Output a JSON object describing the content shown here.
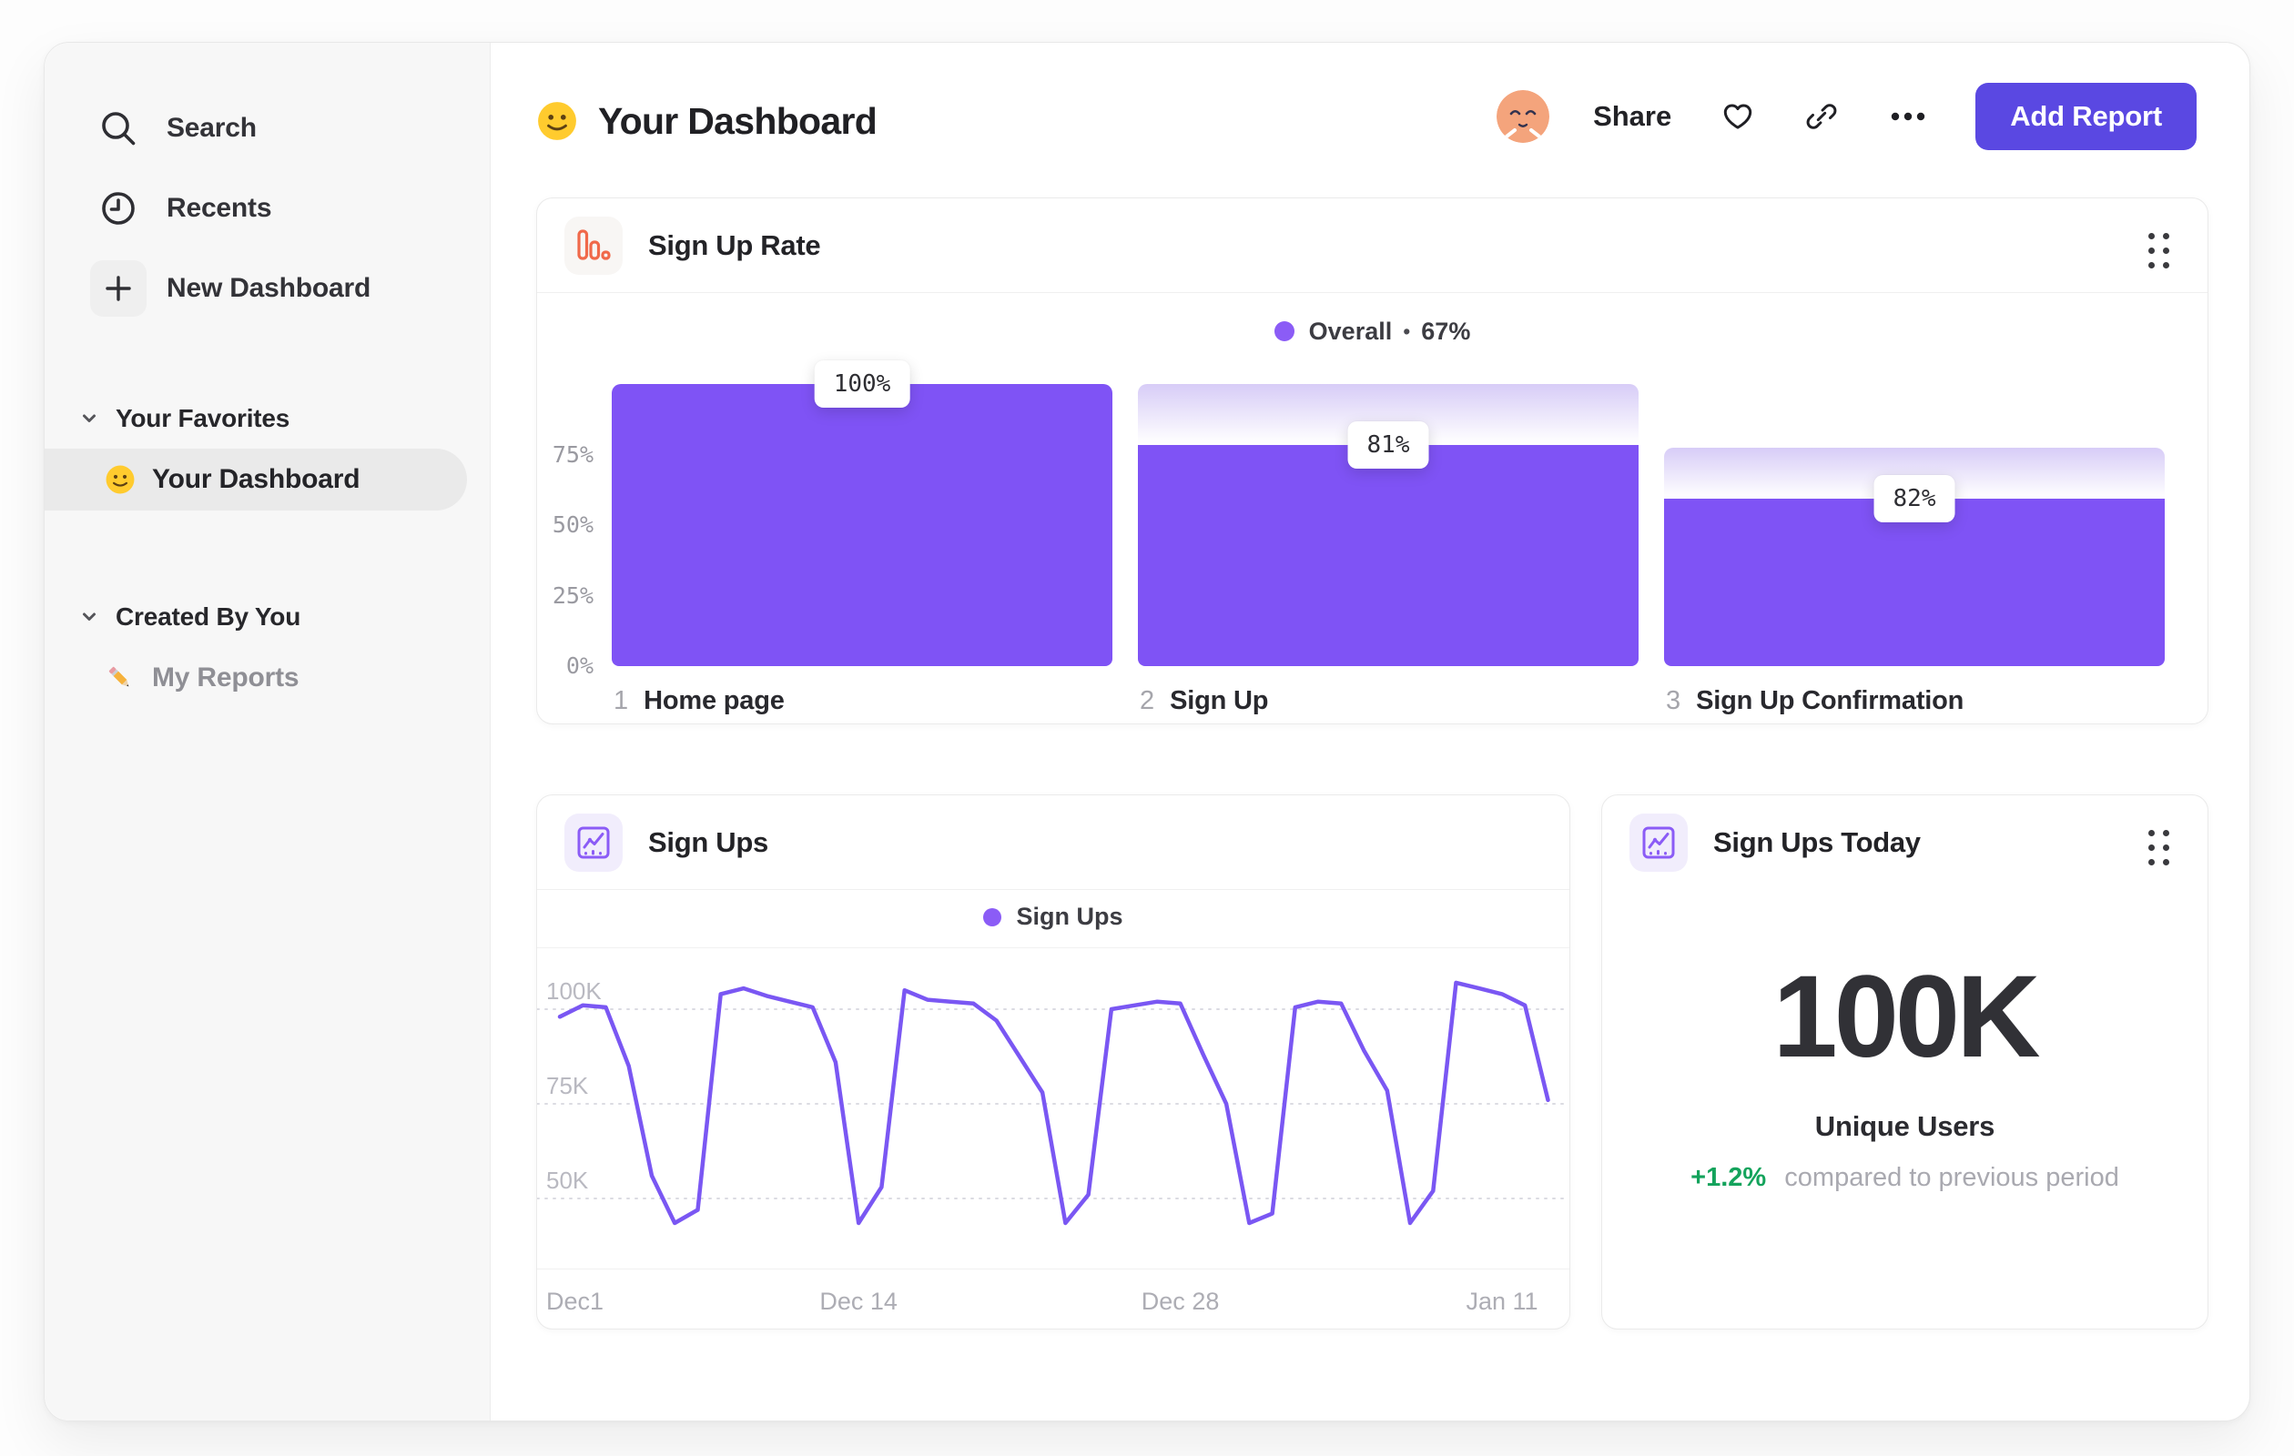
{
  "app": {
    "header": {
      "emoji": "slightly-smiling-face",
      "title": "Your Dashboard",
      "share_label": "Share",
      "add_report_label": "Add Report"
    },
    "sidebar": {
      "nav": [
        {
          "icon": "search-icon",
          "label": "Search"
        },
        {
          "icon": "clock-icon",
          "label": "Recents"
        },
        {
          "icon": "plus-icon",
          "label": "New Dashboard"
        }
      ],
      "sections": [
        {
          "title": "Your Favorites",
          "items": [
            {
              "emoji": "slightly-smiling-face",
              "label": "Your Dashboard",
              "selected": true
            }
          ]
        },
        {
          "title": "Created By You",
          "items": [
            {
              "emoji": "pencil",
              "label": "My Reports",
              "selected": false
            }
          ]
        }
      ]
    },
    "colors": {
      "bar_purple": "#7F53F5",
      "legend_purple": "#8B5CF6",
      "line_purple": "#7A57F3",
      "button_indigo": "#5A48E2",
      "icon_orange": "#F0694A",
      "positive_green": "#14A35C"
    }
  },
  "cards": {
    "signup_rate": {
      "title": "Sign Up Rate",
      "legend_label": "Overall",
      "legend_sep": "•",
      "legend_value": "67%"
    },
    "signups": {
      "title": "Sign Ups",
      "legend_label": "Sign Ups"
    },
    "signups_today": {
      "title": "Sign Ups Today",
      "metric_value": "100K",
      "metric_label": "Unique Users",
      "delta": "+1.2%",
      "delta_caption": "compared to previous period"
    }
  },
  "chart_data": [
    {
      "type": "bar",
      "subtype": "funnel",
      "title": "Sign Up Rate",
      "legend": "Overall • 67%",
      "overall_conversion_pct": 67,
      "ylim": [
        0,
        100
      ],
      "y_ticks": [
        {
          "label": "75%",
          "pct": 75
        },
        {
          "label": "50%",
          "pct": 50
        },
        {
          "label": "25%",
          "pct": 25
        },
        {
          "label": "0%",
          "pct": 0
        }
      ],
      "steps": [
        {
          "order": "1",
          "label": "Home page",
          "badge": "100%",
          "solid_pct": 100,
          "ghost_pct": 100
        },
        {
          "order": "2",
          "label": "Sign Up",
          "badge": "81%",
          "solid_pct": 78.5,
          "ghost_pct": 100
        },
        {
          "order": "3",
          "label": "Sign Up Confirmation",
          "badge": "82%",
          "solid_pct": 59.5,
          "ghost_pct": 77.5
        }
      ]
    },
    {
      "type": "line",
      "title": "Sign Ups",
      "series": [
        {
          "name": "Sign Ups",
          "values_thousands": [
            98,
            101,
            100.5,
            85,
            56,
            43.5,
            47,
            104,
            105.5,
            103.5,
            102,
            100.5,
            86,
            43.5,
            53,
            105,
            102.5,
            102,
            101.5,
            97,
            87.5,
            78,
            43.5,
            51,
            100,
            101,
            102,
            101.5,
            88,
            75,
            43.5,
            46,
            100.5,
            102,
            101.5,
            89,
            78.5,
            43.5,
            52,
            107,
            105.5,
            104,
            101,
            76
          ]
        }
      ],
      "x_ticks": [
        {
          "label": "Dec1",
          "day": 0
        },
        {
          "label": "Dec 14",
          "day": 13
        },
        {
          "label": "Dec 28",
          "day": 27
        },
        {
          "label": "Jan 11",
          "day": 41
        }
      ],
      "y_ticks": [
        {
          "label": "100K",
          "value": 100
        },
        {
          "label": "75K",
          "value": 75
        },
        {
          "label": "50K",
          "value": 50
        }
      ],
      "ylim_thousands": [
        35,
        110
      ],
      "grid": "dotted-horizontal",
      "legend_position": "top-center"
    }
  ]
}
